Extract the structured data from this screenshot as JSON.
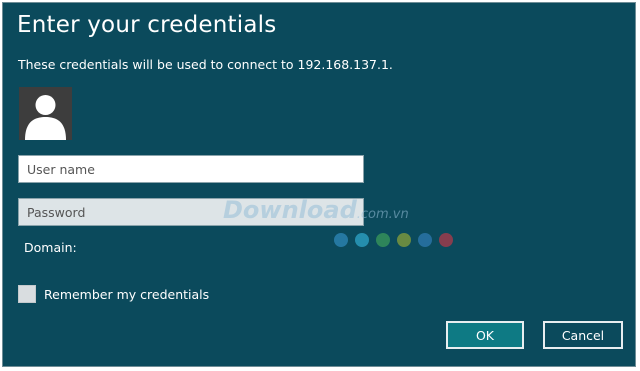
{
  "dialog": {
    "title": "Enter your credentials",
    "subtitle": "These credentials will be used to connect to 192.168.137.1.",
    "avatar_icon": "user-silhouette-icon",
    "username": {
      "value": "",
      "placeholder": "User name"
    },
    "password": {
      "value": "",
      "placeholder": "Password"
    },
    "domain_label": "Domain:",
    "remember": {
      "label": "Remember my credentials",
      "checked": false
    },
    "ok_label": "OK",
    "cancel_label": "Cancel"
  },
  "watermark": {
    "text": "Download",
    "suffix": ".com.vn",
    "dot_colors": [
      "#2f88b8",
      "#2fa5c8",
      "#3b9a5a",
      "#8aa03a",
      "#2f7ab0",
      "#b03a4a"
    ]
  },
  "colors": {
    "background": "#0b4a5c",
    "ok_button": "#0e7a84",
    "text": "#ffffff"
  }
}
